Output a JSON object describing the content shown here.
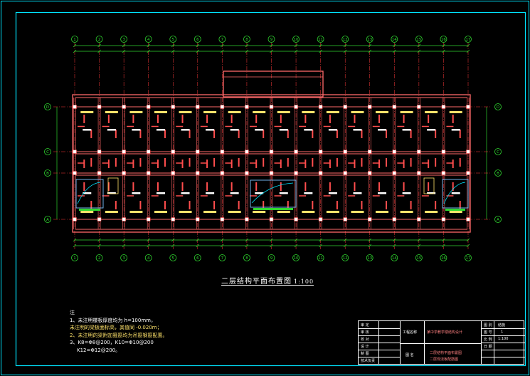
{
  "drawing": {
    "title": "二层结构平面布置图",
    "scale": "1:100"
  },
  "notes": {
    "heading": "注",
    "line1": "1、未注明楼板厚度均为 h=100mm，",
    "line2": "未注明的梁板面标高，其值同 -0.020m；",
    "line3": "2、未注明的梁附加箍筋均为吊筋钢筋配置。",
    "line4": "3、K8=Φ8@200，K10=Φ10@200",
    "line5": "K12=Φ12@200。"
  },
  "axis_labels": {
    "vertical": [
      "1",
      "2",
      "3",
      "4",
      "5",
      "6",
      "7",
      "8",
      "9",
      "10",
      "11",
      "12",
      "13",
      "14",
      "15",
      "16",
      "17"
    ],
    "horizontal": [
      "A",
      "B",
      "C",
      "D"
    ]
  },
  "title_block": {
    "label_col": [
      "审 定",
      "审 核",
      "校 对",
      "设 计",
      "制 图",
      "技术负责"
    ],
    "project_label": "工程名称",
    "project_name": "某中学教学楼结构设计",
    "drawing_label": "图 名",
    "drawing_name_1": "二层结构平面布置图",
    "drawing_name_2": "二层现浇板配筋图",
    "field_1": "图 别",
    "field_1_val": "结施",
    "field_2": "图 号",
    "field_2_val": "1",
    "field_3": "比 例",
    "field_3_val": "1:100",
    "field_4": "日 期",
    "field_4_val": ""
  },
  "colors": {
    "background": "#000000",
    "frame": "#00e5ff",
    "beam": "#ff6a6a",
    "grid": "#ff3b3b",
    "dim": "#2fd52f",
    "text": "#ffffff",
    "label_yellow": "#ffe36b",
    "axis_bubble": "#2fd52f"
  }
}
